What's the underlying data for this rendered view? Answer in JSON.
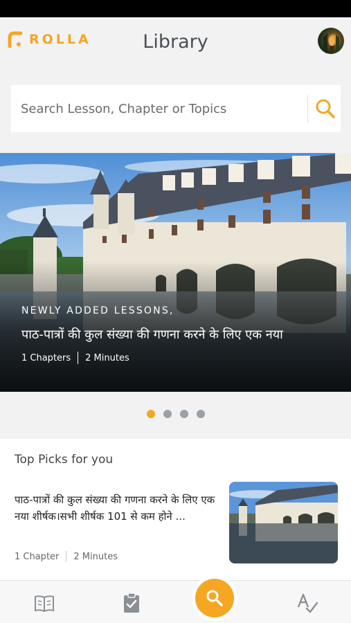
{
  "brand": {
    "name": "ROLLA",
    "color": "#f5a623"
  },
  "header": {
    "title": "Library",
    "avatar_icon": "avatar"
  },
  "search": {
    "placeholder": "Search Lesson, Chapter or Topics",
    "value": "",
    "icon": "search-icon"
  },
  "hero": {
    "kicker": "NEWLY ADDED LESSONS,",
    "title": "पाठ-पात्रों की कुल संख्या की गणना करने के लिए एक नया",
    "chapters": "1 Chapters",
    "duration": "2 Minutes"
  },
  "carousel": {
    "count": 4,
    "active_index": 0
  },
  "top_picks": {
    "title": "Top Picks for you",
    "items": [
      {
        "text": "पाठ-पात्रों की कुल संख्या की गणना करने के लिए एक नया शीर्षक।सभी शीर्षक 101 से कम होने ...",
        "chapters": "1 Chapter",
        "duration": "2 Minutes"
      }
    ]
  },
  "tabbar": {
    "items": [
      {
        "icon": "book-icon"
      },
      {
        "icon": "clipboard-check-icon"
      },
      {
        "icon": "search-icon",
        "active": true
      },
      {
        "icon": "spellcheck-icon"
      }
    ]
  },
  "colors": {
    "accent": "#f5a623",
    "title": "#4a4f55",
    "background": "#f2f2f2"
  }
}
